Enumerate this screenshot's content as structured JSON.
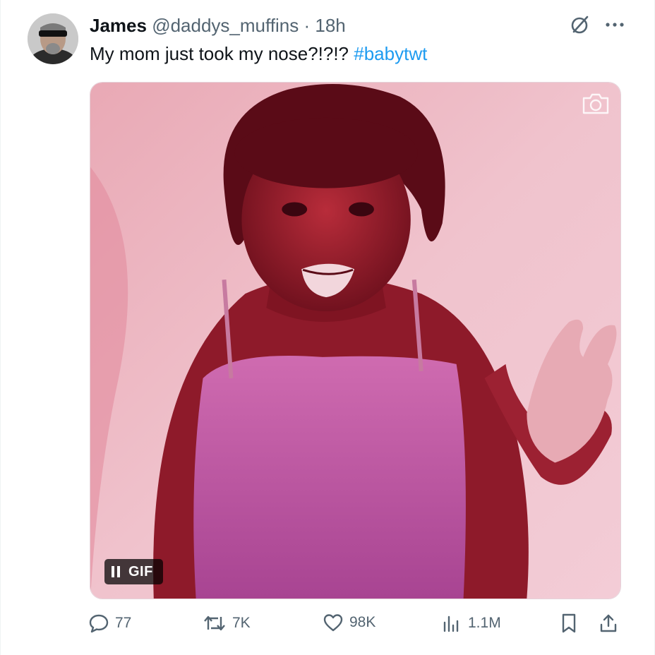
{
  "author": {
    "name": "James",
    "handle": "@daddys_muffins",
    "separator": "·",
    "time": "18h"
  },
  "tweet": {
    "text": "My mom just took my nose?!?!? ",
    "hashtag": "#babytwt"
  },
  "media": {
    "gif_label": "GIF",
    "tint_color": "#e8b4c4"
  },
  "actions": {
    "replies": "77",
    "reposts": "7K",
    "likes": "98K",
    "views": "1.1M"
  },
  "colors": {
    "text": "#0f1419",
    "secondary": "#536471",
    "link": "#1d9bf0"
  },
  "icons": [
    "grok-icon",
    "more-icon",
    "camera-icon",
    "pause-icon",
    "reply-icon",
    "repost-icon",
    "like-icon",
    "views-icon",
    "bookmark-icon",
    "share-icon"
  ]
}
